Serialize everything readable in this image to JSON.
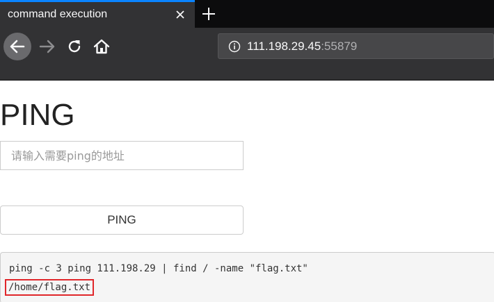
{
  "browser": {
    "tab": {
      "title": "command execution",
      "active_indicator_color": "#0a84ff"
    },
    "icons": {
      "close": "close-icon",
      "new_tab": "plus-icon",
      "back": "arrow-left-icon",
      "forward": "arrow-right-icon",
      "reload": "reload-icon",
      "home": "home-icon",
      "site_info": "info-icon"
    },
    "url": {
      "host": "111.198.29.45",
      "port": ":55879"
    }
  },
  "page": {
    "title": "PING",
    "input": {
      "value": "",
      "placeholder": "请输入需要ping的地址"
    },
    "button_label": "PING",
    "output": {
      "lines": [
        "ping -c 3 ping 111.198.29 | find / -name \"flag.txt\"",
        "/home/flag.txt"
      ],
      "highlight_color": "#e0262a"
    }
  }
}
